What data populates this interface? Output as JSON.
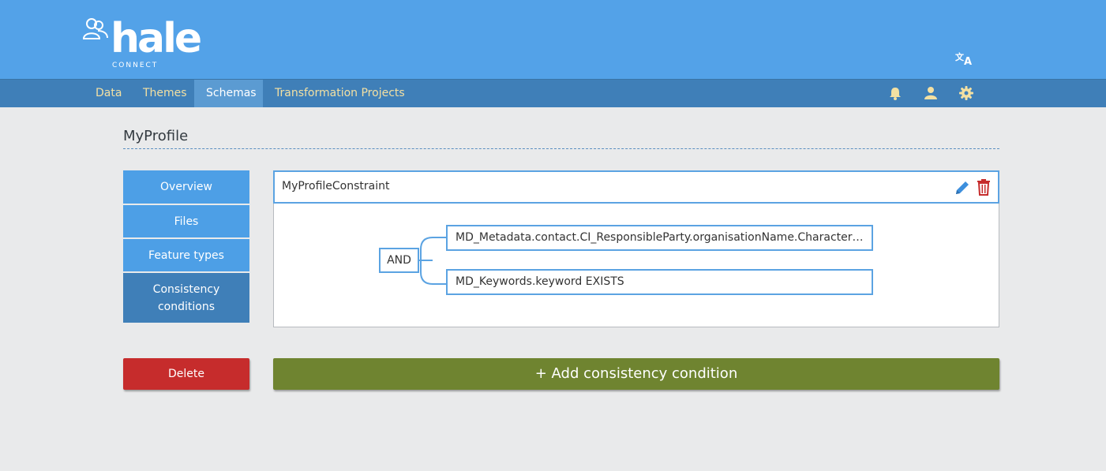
{
  "app": {
    "logo_text": "hale",
    "logo_sub": "CONNECT"
  },
  "nav": {
    "items": [
      {
        "label": "Data"
      },
      {
        "label": "Themes"
      },
      {
        "label": "Schemas",
        "active": true
      },
      {
        "label": "Transformation Projects"
      }
    ],
    "icons": [
      "bell-icon",
      "user-icon",
      "gear-icon"
    ],
    "lang_icon": "translate-icon"
  },
  "page": {
    "title": "MyProfile"
  },
  "sidebar": {
    "items": [
      {
        "label": "Overview"
      },
      {
        "label": "Files"
      },
      {
        "label": "Feature types"
      },
      {
        "label": "Consistency\nconditions",
        "active": true
      }
    ]
  },
  "constraint": {
    "name": "MyProfileConstraint",
    "operator": "AND",
    "conditions": [
      "MD_Metadata.contact.CI_ResponsibleParty.organisationName.CharacterString E...",
      "MD_Keywords.keyword EXISTS"
    ]
  },
  "actions": {
    "delete_label": "Delete",
    "add_label": "+ Add consistency condition"
  },
  "colors": {
    "header": "#53a2e8",
    "nav": "#3f7fb8",
    "accent": "#4d9fe6",
    "delete": "#c62c2c",
    "add": "#6f8430",
    "nav_text": "#f3e0a2"
  }
}
